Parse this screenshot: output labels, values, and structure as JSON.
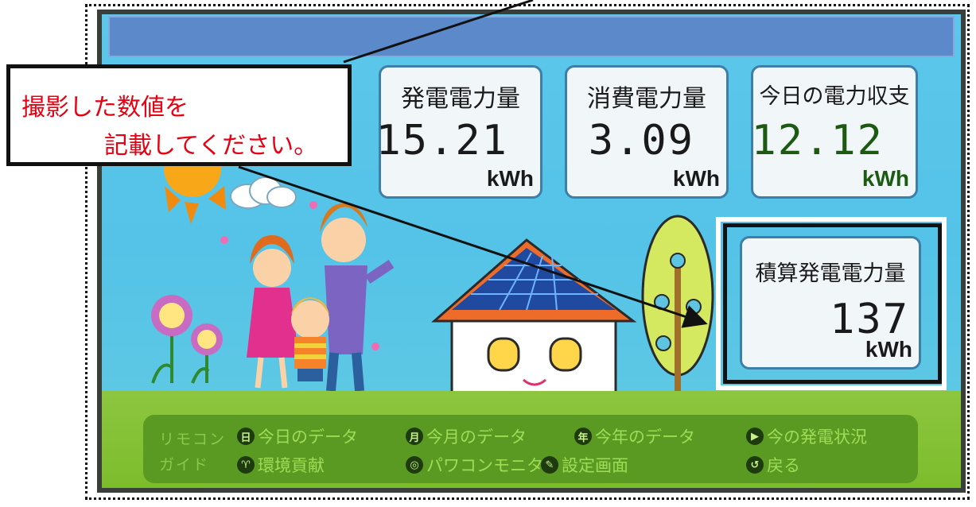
{
  "callout": {
    "line1": "撮影した数値を",
    "line2": "記載してください。"
  },
  "panels": {
    "generation": {
      "title": "発電電力量",
      "value": "15.21",
      "unit": "kWh"
    },
    "consumption": {
      "title": "消費電力量",
      "value": "3.09",
      "unit": "kWh"
    },
    "balance": {
      "title": "今日の電力収支",
      "value": "12.12",
      "unit": "kWh"
    },
    "cumulative": {
      "title": "積算発電電力量",
      "value": "137",
      "unit": "kWh"
    }
  },
  "guide": {
    "label_line1": "リモコン",
    "label_line2": "ガイド",
    "items": [
      {
        "badge": "日",
        "label": "今日のデータ"
      },
      {
        "badge": "月",
        "label": "今月のデータ"
      },
      {
        "badge": "年",
        "label": "今年のデータ"
      },
      {
        "badge": "▶",
        "label": "今の発電状況"
      },
      {
        "badge": "♈",
        "label": "環境貢献"
      },
      {
        "badge": "◎",
        "label": "パワコンモニタ"
      },
      {
        "badge": "✎",
        "label": "設定画面"
      },
      {
        "badge": "↺",
        "label": "戻る"
      }
    ]
  },
  "colors": {
    "callout_text": "#e60012",
    "title_bar": "#5b89c9",
    "sky": "#54c3e7",
    "grass": "#8dc63f",
    "guide_bg": "#5a9a22",
    "guide_text": "#9fdc55",
    "balance_value": "#1c5a12"
  }
}
